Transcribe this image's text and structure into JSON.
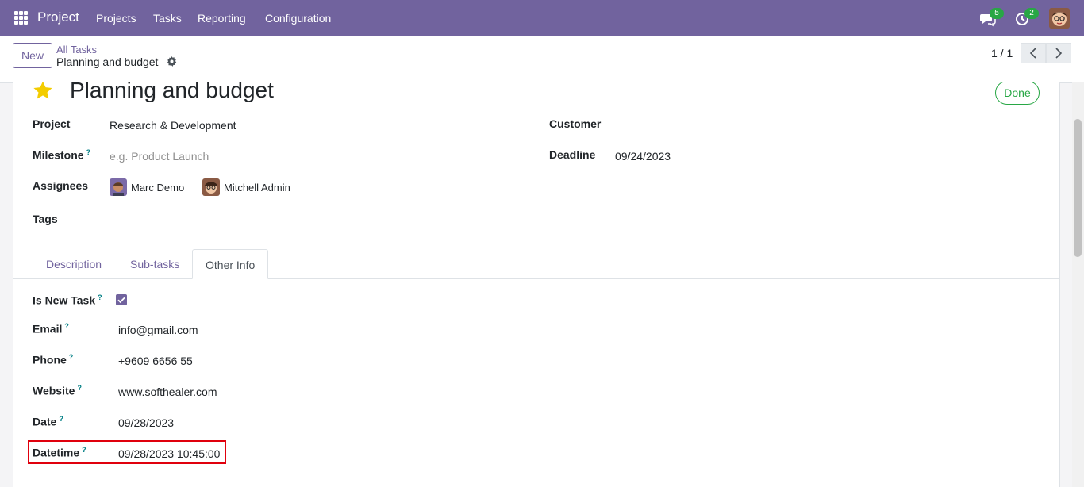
{
  "nav": {
    "brand": "Project",
    "menu": [
      "Projects",
      "Tasks",
      "Reporting",
      "Configuration"
    ],
    "messages_count": "5",
    "activities_count": "2"
  },
  "control": {
    "new_label": "New",
    "breadcrumb_parent": "All Tasks",
    "breadcrumb_current": "Planning and budget",
    "pager": "1 / 1"
  },
  "task": {
    "title": "Planning and budget",
    "stage": "Done",
    "fields": {
      "project_label": "Project",
      "project_value": "Research & Development",
      "milestone_label": "Milestone",
      "milestone_placeholder": "e.g. Product Launch",
      "assignees_label": "Assignees",
      "assignees": [
        "Marc Demo",
        "Mitchell Admin"
      ],
      "tags_label": "Tags",
      "customer_label": "Customer",
      "deadline_label": "Deadline",
      "deadline_value": "09/24/2023"
    },
    "help_mark": "?"
  },
  "tabs": [
    "Description",
    "Sub-tasks",
    "Other Info"
  ],
  "other_info": {
    "is_new_task_label": "Is New Task",
    "is_new_task_checked": true,
    "email_label": "Email",
    "email_value": "info@gmail.com",
    "phone_label": "Phone",
    "phone_value": "+9609 6656 55",
    "website_label": "Website",
    "website_value": "www.softhealer.com",
    "date_label": "Date",
    "date_value": "09/28/2023",
    "datetime_label": "Datetime",
    "datetime_value": "09/28/2023 10:45:00"
  },
  "colors": {
    "brand": "#71639e",
    "success": "#28a745",
    "highlight": "#e0000d",
    "star": "#f3cc00"
  }
}
